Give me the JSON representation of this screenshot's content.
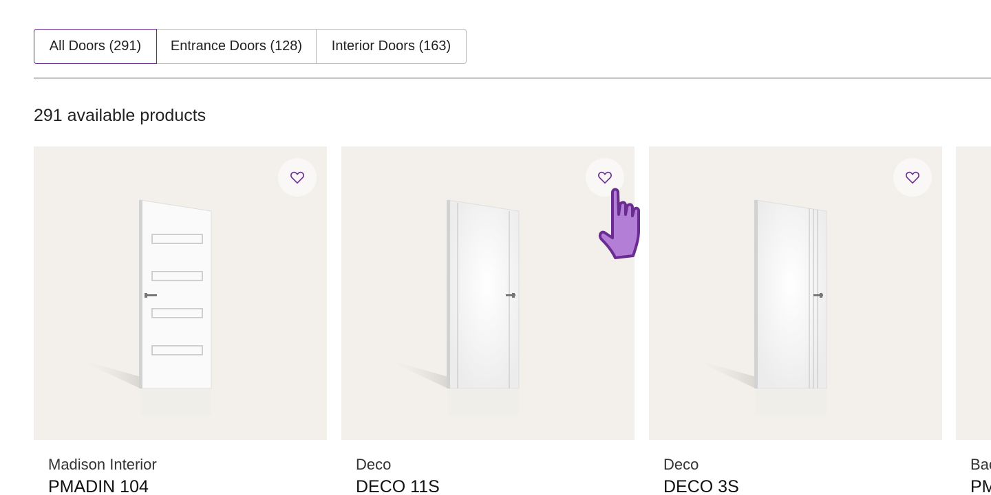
{
  "tabs": [
    {
      "label": "All Doors (291)",
      "active": true
    },
    {
      "label": "Entrance Doors (128)",
      "active": false
    },
    {
      "label": "Interior Doors (163)",
      "active": false
    }
  ],
  "results": {
    "count_text": "291 available products"
  },
  "products": [
    {
      "brand": "Madison Interior",
      "name": "PMADIN 104",
      "door_style": "horizontal-panels",
      "favorite_icon": "heart-outline-icon"
    },
    {
      "brand": "Deco",
      "name": "DECO 11S",
      "door_style": "side-grooves",
      "favorite_icon": "heart-outline-icon"
    },
    {
      "brand": "Deco",
      "name": "DECO 3S",
      "door_style": "triple-grooves",
      "favorite_icon": "heart-outline-icon"
    },
    {
      "brand": "Bac",
      "name": "PM",
      "door_style": "partially-visible",
      "favorite_icon": "heart-outline-icon"
    }
  ],
  "colors": {
    "accent": "#6b2c91",
    "card_bg": "#f3f0ec",
    "cursor_fill": "#b37ed6"
  }
}
